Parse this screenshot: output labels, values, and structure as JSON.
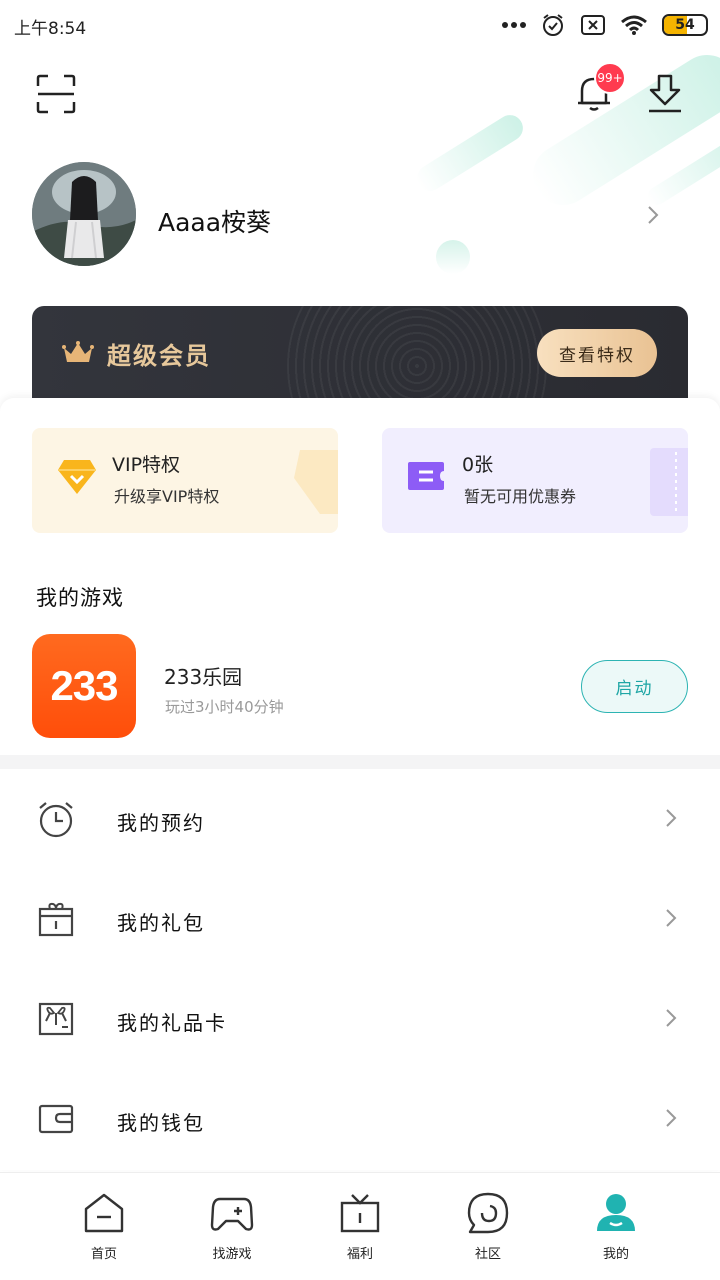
{
  "status_bar": {
    "time": "上午8:54",
    "battery": "54",
    "battery_level": 0.54
  },
  "header": {
    "notification_badge": "99+",
    "username": "Aaaa桉葵"
  },
  "vip_banner": {
    "title": "超级会员",
    "button_label": "查看特权"
  },
  "cards": {
    "vip": {
      "title": "VIP特权",
      "subtitle": "升级享VIP特权"
    },
    "coupon": {
      "title": "0张",
      "subtitle": "暂无可用优惠券"
    }
  },
  "my_games": {
    "section_title": "我的游戏",
    "game": {
      "icon_text": "233",
      "name": "233乐园",
      "playtime": "玩过3小时40分钟",
      "launch_label": "启动"
    }
  },
  "menu": [
    {
      "label": "我的预约",
      "icon": "alarm-clock-icon"
    },
    {
      "label": "我的礼包",
      "icon": "gift-box-icon"
    },
    {
      "label": "我的礼品卡",
      "icon": "gift-card-icon"
    },
    {
      "label": "我的钱包",
      "icon": "wallet-icon"
    }
  ],
  "bottom_nav": {
    "items": [
      {
        "label": "首页",
        "icon": "home-icon"
      },
      {
        "label": "找游戏",
        "icon": "gamepad-icon"
      },
      {
        "label": "福利",
        "icon": "gift-icon"
      },
      {
        "label": "社区",
        "icon": "community-icon"
      },
      {
        "label": "我的",
        "icon": "profile-icon"
      }
    ],
    "active_index": 4
  },
  "colors": {
    "accent": "#20b3b1",
    "vip_gold": "#e7c89b",
    "badge_red": "#ff3b4f",
    "game_orange": "#ff5a12"
  }
}
